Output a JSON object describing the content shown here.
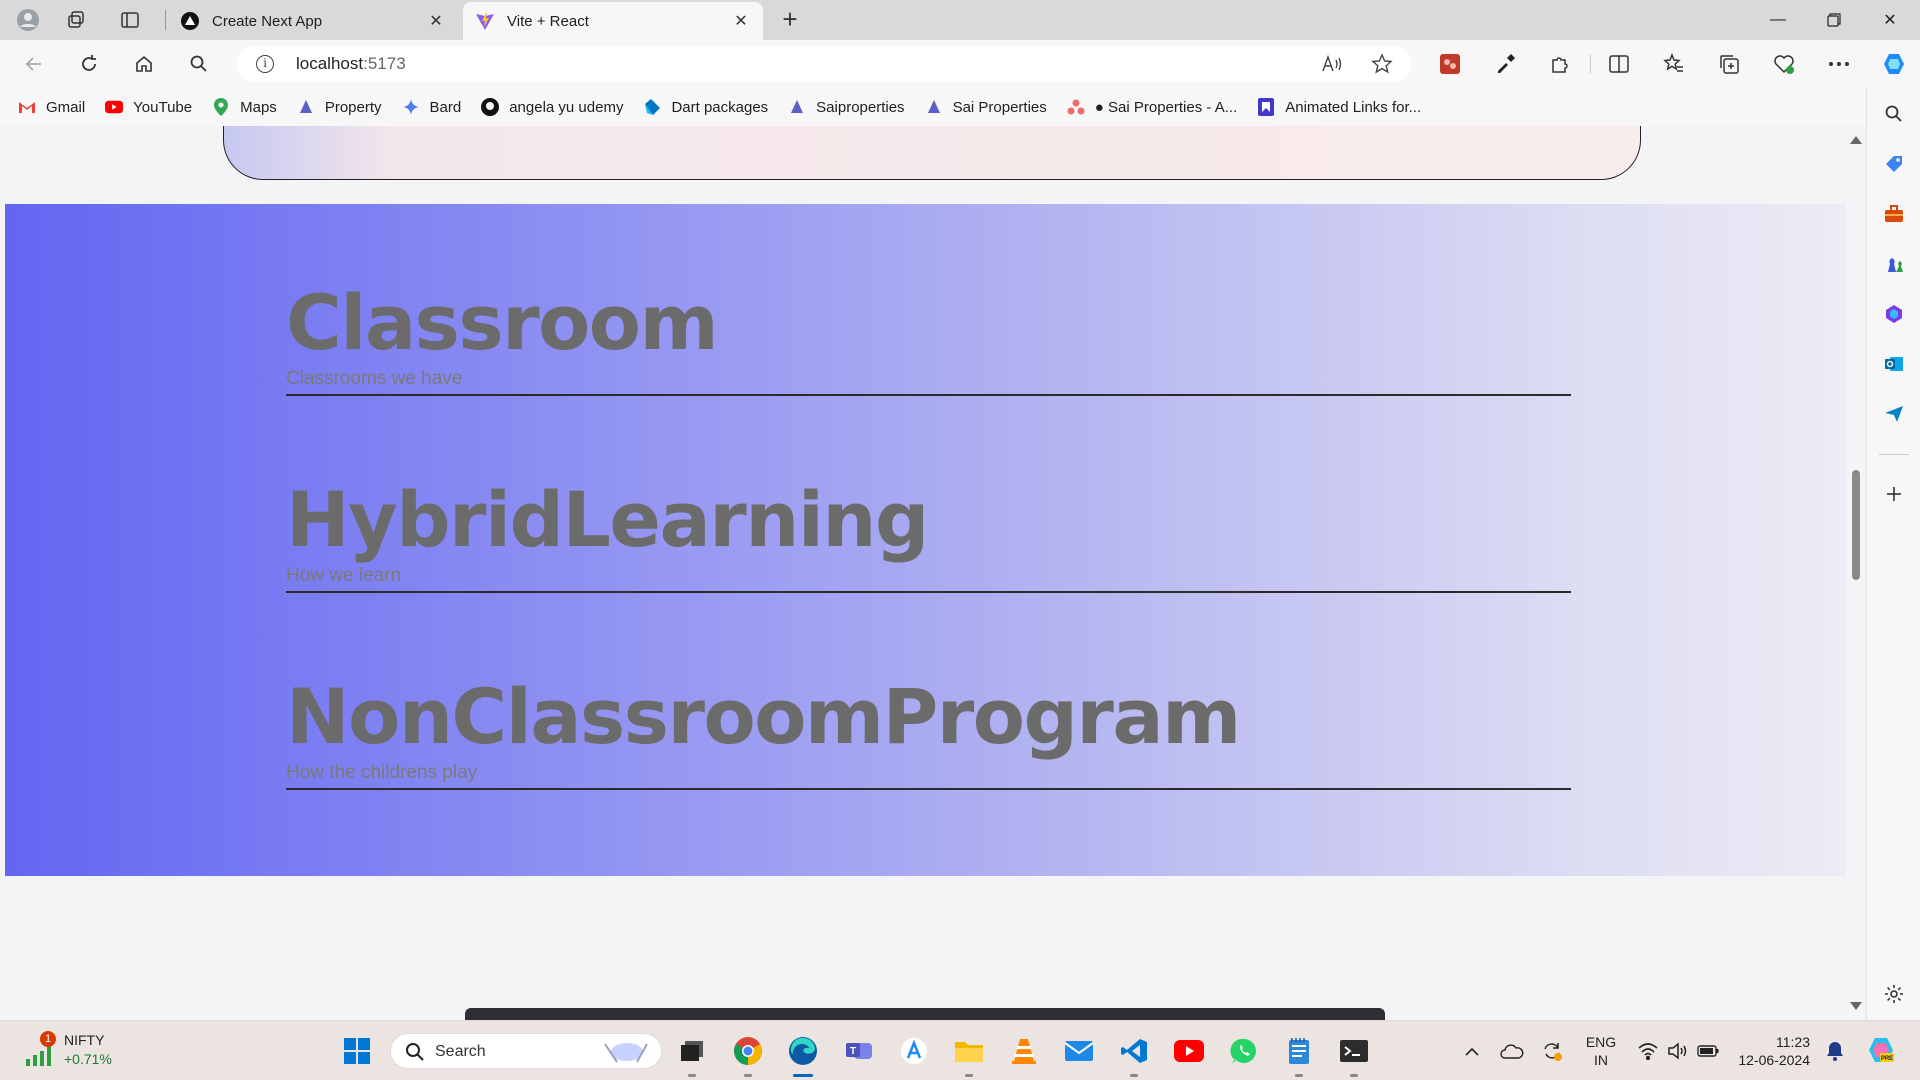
{
  "browser": {
    "tabs": [
      {
        "title": "Create Next App",
        "active": false
      },
      {
        "title": "Vite + React",
        "active": true
      }
    ],
    "url_host": "localhost",
    "url_port": ":5173",
    "bookmarks": [
      {
        "label": "Gmail",
        "icon": "gmail-icon"
      },
      {
        "label": "YouTube",
        "icon": "youtube-icon"
      },
      {
        "label": "Maps",
        "icon": "maps-icon"
      },
      {
        "label": "Property",
        "icon": "property-icon"
      },
      {
        "label": "Bard",
        "icon": "bard-icon"
      },
      {
        "label": "angela yu udemy",
        "icon": "github-icon"
      },
      {
        "label": "Dart packages",
        "icon": "dart-icon"
      },
      {
        "label": "Saiproperties",
        "icon": "property-icon"
      },
      {
        "label": "Sai Properties",
        "icon": "property-icon"
      },
      {
        "label": "● Sai Properties - A...",
        "icon": "asana-icon"
      },
      {
        "label": "Animated Links for...",
        "icon": "bookmark-icon"
      }
    ]
  },
  "page": {
    "sections": [
      {
        "title": "Classroom",
        "subtitle": "Classrooms we have"
      },
      {
        "title": "HybridLearning",
        "subtitle": "How we learn"
      },
      {
        "title": "NonClassroomProgram",
        "subtitle": "How the childrens play"
      }
    ]
  },
  "taskbar": {
    "widget_name": "NIFTY",
    "widget_change": "+0.71%",
    "widget_badge": "1",
    "search_label": "Search",
    "lang_line1": "ENG",
    "lang_line2": "IN",
    "time": "11:23",
    "date": "12-06-2024"
  },
  "colors": {
    "hero_start": "#6366f1",
    "heading": "#6b6b6b"
  }
}
